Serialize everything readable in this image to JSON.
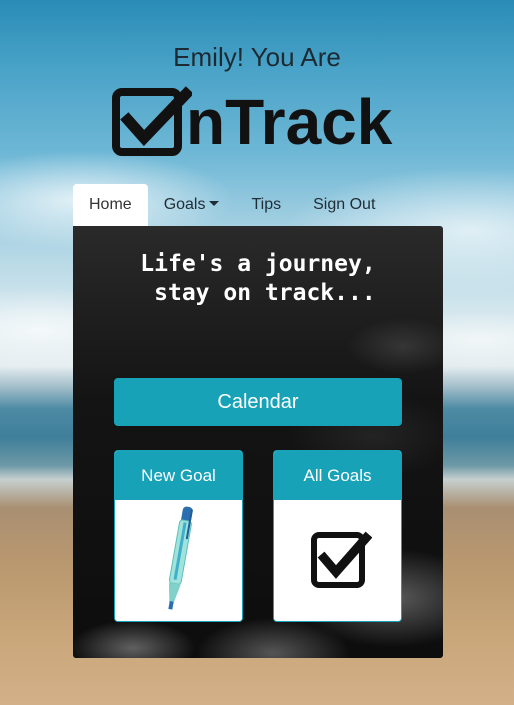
{
  "header": {
    "greeting": "Emily! You Are",
    "logo_text": "nTrack"
  },
  "nav": {
    "items": [
      {
        "label": "Home",
        "active": true
      },
      {
        "label": "Goals",
        "dropdown": true
      },
      {
        "label": "Tips"
      },
      {
        "label": "Sign Out"
      }
    ]
  },
  "main": {
    "tagline": "Life's a journey,\n stay on track...",
    "calendar_button": "Calendar",
    "cards": [
      {
        "title": "New Goal",
        "icon": "pen-icon"
      },
      {
        "title": "All Goals",
        "icon": "checkbox-icon"
      }
    ]
  },
  "colors": {
    "accent": "#17a2b8",
    "panel": "#141414"
  }
}
